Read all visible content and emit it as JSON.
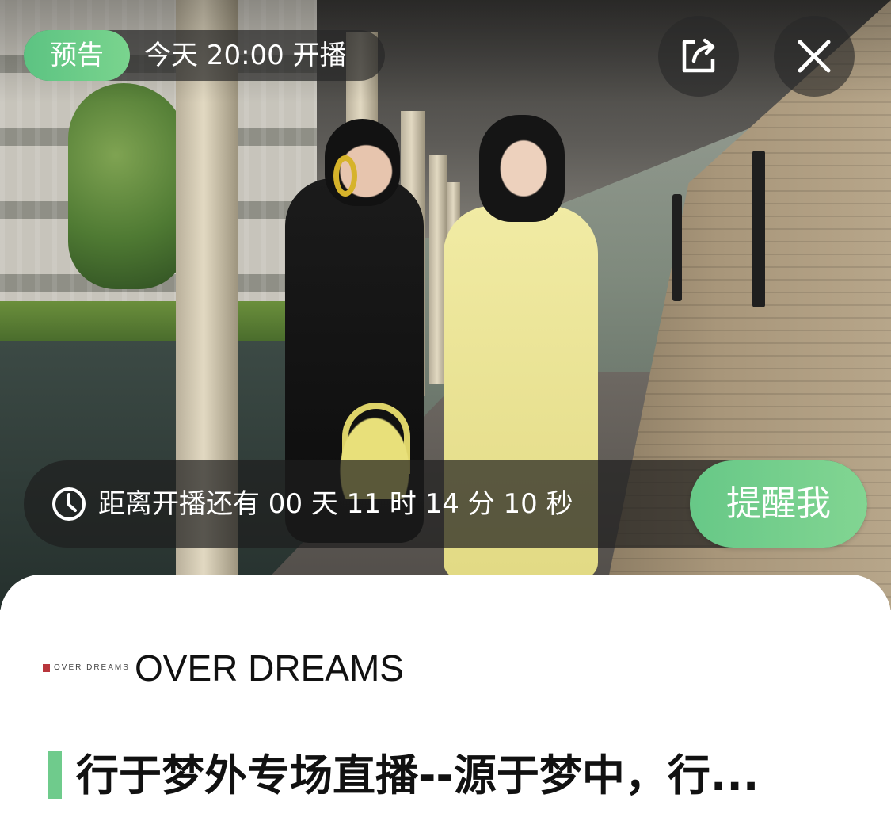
{
  "header": {
    "badge_label": "预告",
    "start_time": "今天 20:00 开播"
  },
  "icons": {
    "share": "share-icon",
    "close": "close-icon",
    "clock": "clock-icon"
  },
  "countdown": {
    "text": "距离开播还有 00 天 11 时 14 分 10 秒",
    "remind_label": "提醒我"
  },
  "info": {
    "brand_logo_text": "OVER DREAMS",
    "brand_name": "OVER DREAMS",
    "title": "行于梦外专场直播--源于梦中，行..."
  },
  "colors": {
    "accent_green": "#6fcb8c",
    "overlay_dark": "rgba(30,30,30,0.70)",
    "text_primary": "#111111"
  }
}
